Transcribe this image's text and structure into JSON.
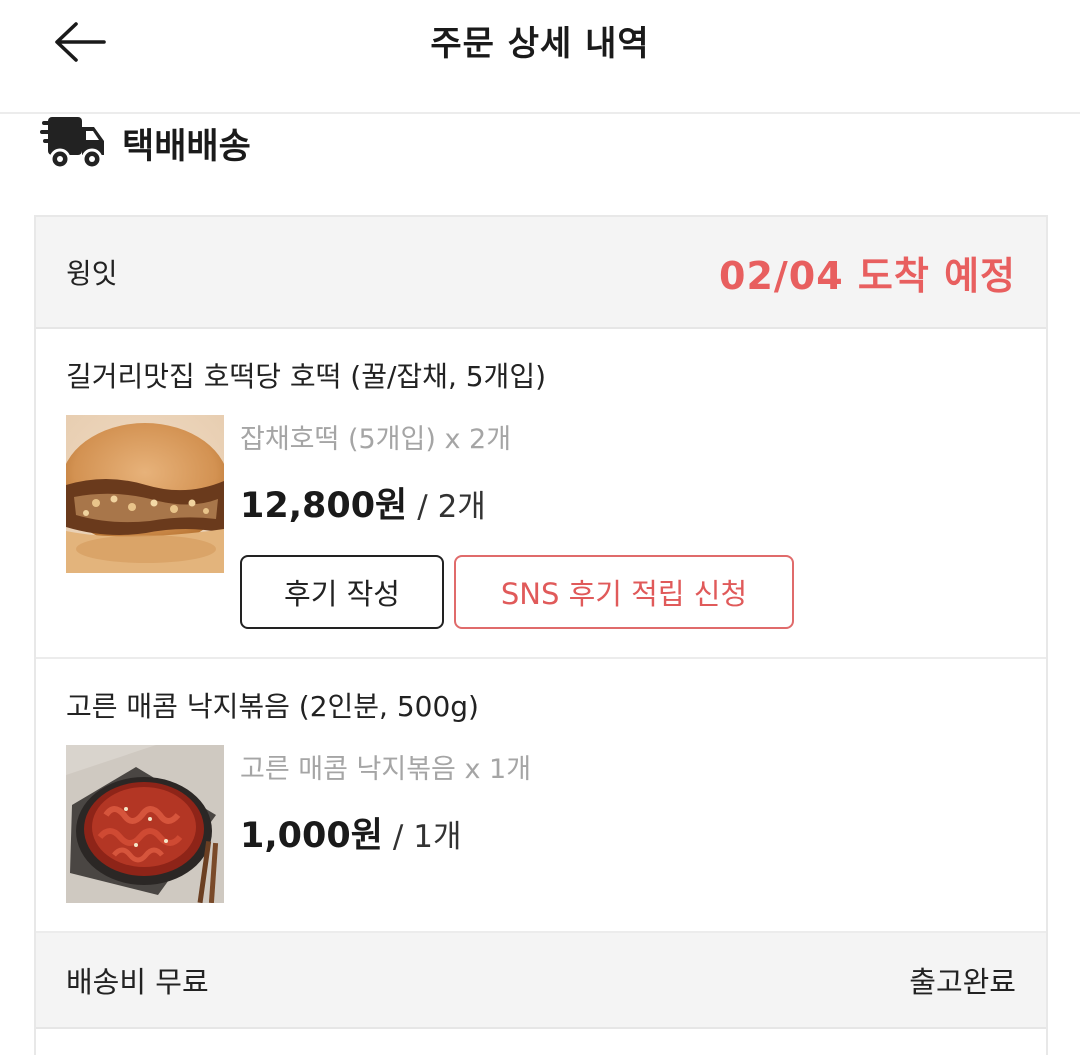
{
  "header": {
    "title": "주문 상세 내역",
    "back_icon": "arrow-left-icon"
  },
  "delivery": {
    "type_label": "택배배송",
    "icon": "truck-icon"
  },
  "seller": {
    "name": "윙잇",
    "arrival": "02/04 도착 예정",
    "arrival_color": "#e85f5f"
  },
  "items": [
    {
      "title": "길거리맛집 호떡당 호떡 (꿀/잡채, 5개입)",
      "option": "잡채호떡 (5개입) x 2개",
      "price": "12,800원",
      "qty": "/ 2개",
      "image": "hotteok-photo",
      "buttons": {
        "review": "후기 작성",
        "sns": "SNS 후기 적립 신청"
      }
    },
    {
      "title": "고른 매콤 낙지볶음 (2인분, 500g)",
      "option": "고른 매콤 낙지볶음 x 1개",
      "price": "1,000원",
      "qty": "/ 1개",
      "image": "nakji-bokkeum-photo"
    }
  ],
  "footer": {
    "shipping_fee": "배송비 무료",
    "status": "출고완료"
  },
  "colors": {
    "accent": "#e85f5f",
    "panel_bg": "#f4f4f4"
  }
}
